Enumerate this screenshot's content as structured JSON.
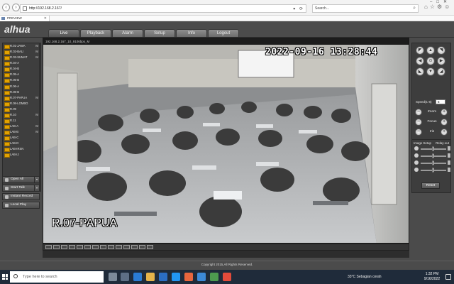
{
  "browser": {
    "address": "http://192.168.2.167/",
    "search_placeholder": "Search...",
    "tab_title": "PREVIEW"
  },
  "app": {
    "logo": "alhua",
    "menu": [
      "Live",
      "Playback",
      "Alarm",
      "Setup",
      "Info",
      "Logout"
    ],
    "active_menu": "Live",
    "footer": "Copyright 2015,All Rights Reserved."
  },
  "channels": [
    {
      "label": "R.01-JAWA",
      "m": "M"
    },
    {
      "label": "R.02-BALI",
      "m": "M"
    },
    {
      "label": "R.03-SUMAT",
      "m": "M"
    },
    {
      "label": "R.04-A",
      "m": ""
    },
    {
      "label": "R.04-B",
      "m": ""
    },
    {
      "label": "R.05-A",
      "m": ""
    },
    {
      "label": "R.05-B",
      "m": ""
    },
    {
      "label": "R.06-A",
      "m": ""
    },
    {
      "label": "R.06-B",
      "m": ""
    },
    {
      "label": "R.07-PAPUA",
      "m": "M"
    },
    {
      "label": "R.08-LOMBO",
      "m": ""
    },
    {
      "label": "R.09",
      "m": ""
    },
    {
      "label": "R.10",
      "m": "M"
    },
    {
      "label": "R.11",
      "m": ""
    },
    {
      "label": "LAB-A",
      "m": "M"
    },
    {
      "label": "LAB-B",
      "m": "M"
    },
    {
      "label": "LAB-C",
      "m": ""
    },
    {
      "label": "LAB-D",
      "m": ""
    },
    {
      "label": "LAB-IRSN",
      "m": ""
    },
    {
      "label": "LAB-IJ",
      "m": ""
    }
  ],
  "left_buttons": {
    "open_all": "Open All",
    "start_talk": "Start Talk",
    "instant_record": "Instant Record",
    "local_play": "Local Play"
  },
  "video": {
    "title": "192.168.2.167_10_9106bps_M",
    "timestamp": "2022-09-16 13:28:44",
    "channel_name": "R.07-PAPUA"
  },
  "ptz": {
    "speed_label": "Speed(1-8)",
    "speed_value": "5",
    "zoom": "Zoom",
    "focus": "Focus",
    "iris": "Iris"
  },
  "image_setup": {
    "title": "Image Setup",
    "relay": "Relay-out",
    "reset": "Reset"
  },
  "taskbar": {
    "search": "Type here to search",
    "weather": "33°C  Sebagian cerah",
    "time": "1:32 PM",
    "date": "9/16/2022"
  },
  "colors": {
    "app_bg": "#4b4b4b",
    "channel_icon": "#e2a200",
    "taskbar": "#1f2b3a"
  }
}
